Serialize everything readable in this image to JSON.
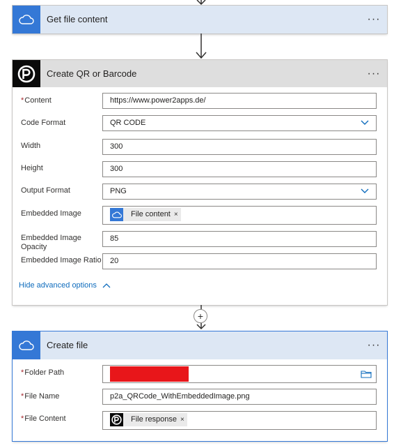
{
  "colors": {
    "accent_blue": "#3478d6",
    "header_blue_bg": "#dde7f4",
    "header_gray_bg": "#dedede",
    "required_red": "#a4262c",
    "link_blue": "#0f6cbd",
    "redaction_red": "#e8161a"
  },
  "step_get_file": {
    "title": "Get file content",
    "icon": "cloud-icon",
    "more": "···"
  },
  "step_qr": {
    "title": "Create QR or Barcode",
    "icon": "power2apps-logo-icon",
    "more": "···",
    "fields": {
      "content": {
        "required": "*",
        "label": "Content",
        "value": "https://www.power2apps.de/"
      },
      "code_format": {
        "label": "Code Format",
        "value": "QR CODE"
      },
      "width": {
        "label": "Width",
        "value": "300"
      },
      "height": {
        "label": "Height",
        "value": "300"
      },
      "output_format": {
        "label": "Output Format",
        "value": "PNG"
      },
      "embedded_image": {
        "label": "Embedded Image",
        "token": "File content",
        "token_icon": "cloud-icon",
        "remove": "×"
      },
      "embedded_opacity": {
        "label_line1": "Embedded Image",
        "label_line2": "Opacity",
        "value": "85"
      },
      "embedded_ratio": {
        "label": "Embedded Image Ratio",
        "value": "20"
      }
    },
    "advanced_toggle": "Hide advanced options"
  },
  "insert_step": {
    "plus": "+"
  },
  "step_create_file": {
    "title": "Create file",
    "icon": "cloud-icon",
    "more": "···",
    "fields": {
      "folder_path": {
        "required": "*",
        "label": "Folder Path"
      },
      "file_name": {
        "required": "*",
        "label": "File Name",
        "value": "p2a_QRCode_WithEmbeddedImage.png"
      },
      "file_content": {
        "required": "*",
        "label": "File Content",
        "token": "File response",
        "token_icon": "power2apps-logo-icon",
        "remove": "×"
      }
    }
  }
}
